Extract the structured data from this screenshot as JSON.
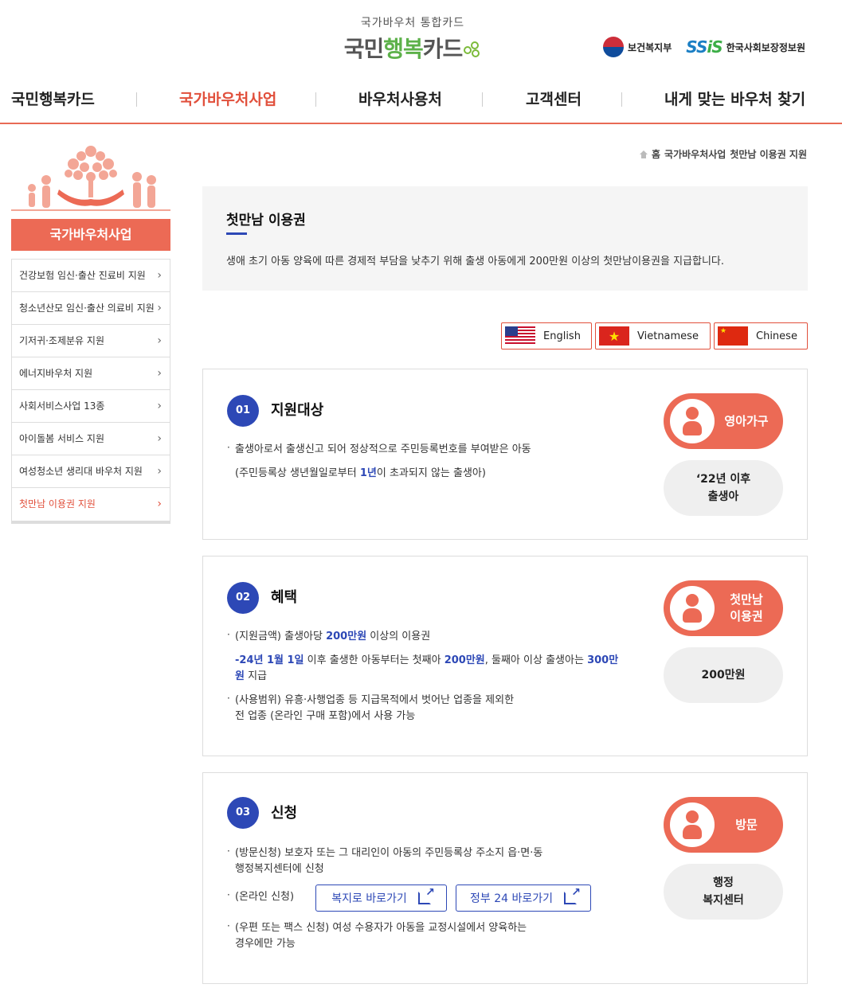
{
  "logo": {
    "sub": "국가바우처 통합카드",
    "main_a": "국민",
    "main_b": "행복",
    "main_c": "카드"
  },
  "partners": {
    "mohw": "보건복지부",
    "ssis_a": "SS",
    "ssis_b": "iS",
    "ssis_name": "한국사회보장정보원"
  },
  "nav": [
    "국민행복카드",
    "국가바우처사업",
    "바우처사용처",
    "고객센터",
    "내게 맞는 바우처 찾기"
  ],
  "sidebar": {
    "title": "국가바우처사업",
    "items": [
      "건강보험 임신·출산 진료비 지원",
      "청소년산모 임신·출산 의료비 지원",
      "기저귀·조제분유 지원",
      "에너지바우처 지원",
      "사회서비스사업 13종",
      "아이돌봄 서비스 지원",
      "여성청소년 생리대 바우처 지원",
      "첫만남 이용권 지원"
    ]
  },
  "breadcrumb": [
    "홈",
    "국가바우처사업",
    "첫만남 이용권 지원"
  ],
  "intro": {
    "title": "첫만남 이용권",
    "desc": "생애 초기 아동 양육에 따른 경제적 부담을 낮추기 위해 출생 아동에게 200만원 이상의 첫만남이용권을 지급합니다."
  },
  "languages": [
    "English",
    "Vietnamese",
    "Chinese"
  ],
  "sections": {
    "s1": {
      "num": "01",
      "title": "지원대상",
      "l1": "출생아로서 출생신고 되어 정상적으로 주민등록번호를 부여받은 아동",
      "l2a": "(주민등록상 생년월일로부터 ",
      "l2b": "1년",
      "l2c": "이 초과되지 않는 출생아)",
      "pill": "영아가구",
      "sub1": "‘22년 이후",
      "sub2": "출생아"
    },
    "s2": {
      "num": "02",
      "title": "혜택",
      "l1a": "(지원금액) 출생아당 ",
      "l1b": "200만원",
      "l1c": " 이상의 이용권",
      "l2a": "-",
      "l2b": "24년 1월 1일",
      "l2c": " 이후 출생한 아동부터는 첫째아 ",
      "l2d": "200만원",
      "l2e": ", 둘째아 이상 출생아는 ",
      "l2f": "300만",
      "l3a": "원",
      "l3b": " 지급",
      "l4": "(사용범위) 유흥·사행업종 등 지급목적에서 벗어난 업종을 제외한",
      "l5": "전 업종 (온라인 구매 포함)에서 사용 가능",
      "pill1": "첫만남",
      "pill2": "이용권",
      "sub": "200만원"
    },
    "s3": {
      "num": "03",
      "title": "신청",
      "l1": "(방문신청) 보호자 또는 그 대리인이 아동의 주민등록상 주소지 읍·면·동",
      "l2": "행정복지센터에 신청",
      "l3": "(온라인 신청)",
      "btn1": "복지로 바로가기",
      "btn2": "정부 24 바로가기",
      "l4": "(우편 또는 팩스 신청) 여성 수용자가 아동을 교정시설에서 양육하는",
      "l5": "경우에만 가능",
      "pill": "방문",
      "sub1": "행정",
      "sub2": "복지센터"
    }
  },
  "colors": {
    "accent": "#ec6a55",
    "blue": "#2d48b6",
    "nav_active": "#e1503c"
  },
  "icons": [
    "home-icon",
    "chevron-right-icon",
    "external-link-icon",
    "infant-icon",
    "parent-child-icon",
    "visit-icon",
    "clover-icon"
  ]
}
